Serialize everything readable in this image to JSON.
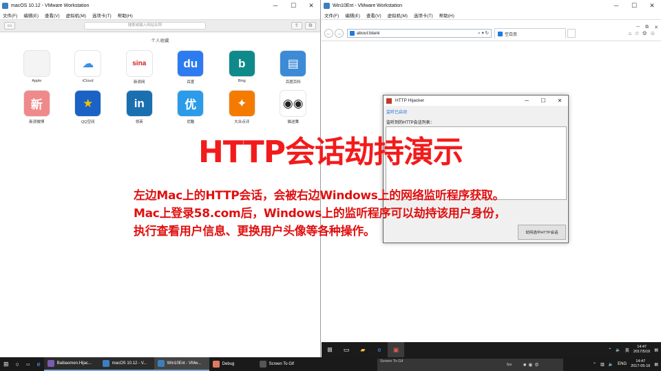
{
  "left_window": {
    "title": "macOS 10.12 - VMware Workstation",
    "menu": [
      "文件(F)",
      "编辑(E)",
      "查看(V)",
      "虚拟机(M)",
      "选项卡(T)",
      "帮助(H)"
    ],
    "search_placeholder": "搜索或输入网站名称",
    "favorites_title": "个人收藏",
    "favorites": [
      {
        "label": "Apple",
        "glyph": "",
        "color": "#f4f4f4",
        "fg": "#555"
      },
      {
        "label": "iCloud",
        "glyph": "☁",
        "color": "#ffffff",
        "fg": "#3a8ee6"
      },
      {
        "label": "新浪网",
        "glyph": "sina",
        "color": "#ffffff",
        "fg": "#d41c1c"
      },
      {
        "label": "百度",
        "glyph": "du",
        "color": "#2d7bf0",
        "fg": "#ffffff"
      },
      {
        "label": "Bing",
        "glyph": "b",
        "color": "#0f8a8a",
        "fg": "#ffffff"
      },
      {
        "label": "百度百科",
        "glyph": "▤",
        "color": "#3d8ad6",
        "fg": "#ffffff"
      },
      {
        "label": "新浪微博",
        "glyph": "新",
        "color": "#f08a8a",
        "fg": "#ffffff"
      },
      {
        "label": "QQ空间",
        "glyph": "★",
        "color": "#1b62c6",
        "fg": "#f5c400"
      },
      {
        "label": "领英",
        "glyph": "in",
        "color": "#1a6fb0",
        "fg": "#ffffff"
      },
      {
        "label": "优酷",
        "glyph": "优",
        "color": "#2c9bea",
        "fg": "#ffffff"
      },
      {
        "label": "大众点评",
        "glyph": "✦",
        "color": "#f57a00",
        "fg": "#ffffff"
      },
      {
        "label": "猫途鹰",
        "glyph": "◉◉",
        "color": "#ffffff",
        "fg": "#222222"
      }
    ]
  },
  "right_window": {
    "title": "Win10Ent - VMware Workstation",
    "menu": [
      "文件(F)",
      "编辑(E)",
      "查看(V)",
      "虚拟机(M)",
      "选项卡(T)",
      "帮助(H)"
    ],
    "address": "about:blank",
    "tab_label": "空白页"
  },
  "hijacker": {
    "title": "HTTP Hijacker",
    "status": "监听已启动",
    "list_label": "监听到的HTTP会话列表：",
    "button": "劫持选中HTTP会话"
  },
  "overlay": {
    "headline": "HTTP会话劫持演示",
    "lines": [
      "左边Mac上的HTTP会话，会被右边Windows上的网络监听程序获取。",
      "Mac上登录58.com后，Windows上的监听程序可以劫持该用户身份，",
      "执行查看用户信息、更换用户头像等各种操作。"
    ]
  },
  "vm_taskbar": {
    "ime": "英",
    "time": "14:47",
    "date": "2017/5/16"
  },
  "host_taskbar": {
    "tasks": [
      "Baibaomen.Hijac...",
      "macOS 10.12 - V...",
      "Win10Ent - VMw...",
      "Debug",
      "Screen To Gif"
    ],
    "screen_to_gif_overlay": "Screen To Gif",
    "fps_label": "fps",
    "ime": "ENG",
    "time": "14:47",
    "date": "2017-05-16"
  }
}
